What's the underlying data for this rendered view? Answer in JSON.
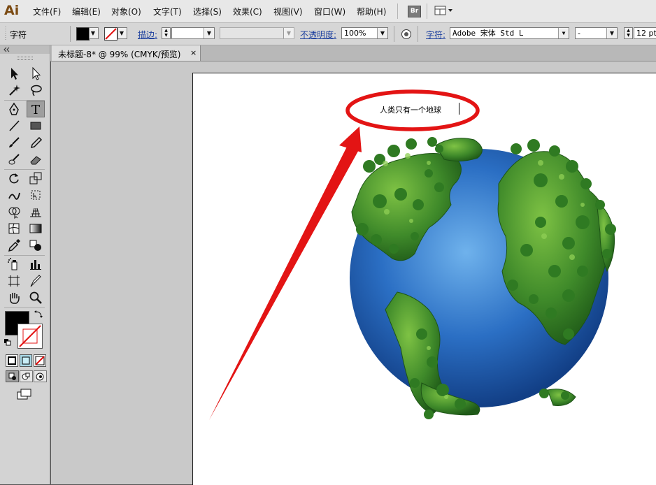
{
  "app": {
    "logo": "Ai",
    "menu": [
      "文件(F)",
      "编辑(E)",
      "对象(O)",
      "文字(T)",
      "选择(S)",
      "效果(C)",
      "视图(V)",
      "窗口(W)",
      "帮助(H)"
    ],
    "bridge_label": "Br"
  },
  "control_bar": {
    "panel_label": "字符",
    "stroke_label": "描边:",
    "opacity_label": "不透明度:",
    "opacity_value": "100%",
    "character_label": "字符:",
    "font_family": "Adobe 宋体 Std L",
    "font_style": "-",
    "font_size": "12 pt"
  },
  "document": {
    "tab_title": "未标题-8* @ 99% (CMYK/预览)",
    "close_glyph": "×",
    "text_content": "人类只有一个地球"
  },
  "colors": {
    "annotation_red": "#e31414",
    "menu_bg": "#e8e8e8",
    "panel_bg": "#d3d3d3",
    "canvas_bg": "#c9c9c9",
    "link_blue": "#1c3f9e",
    "ocean_blue": "#2b6fc4",
    "forest_green": "#3f8a2a"
  },
  "tools": [
    "selection-tool-icon",
    "direct-selection-tool-icon",
    "magic-wand-tool-icon",
    "lasso-tool-icon",
    "pen-tool-icon",
    "type-tool-icon",
    "line-segment-tool-icon",
    "rectangle-tool-icon",
    "paintbrush-tool-icon",
    "pencil-tool-icon",
    "blob-brush-tool-icon",
    "eraser-tool-icon",
    "rotate-tool-icon",
    "scale-tool-icon",
    "warp-tool-icon",
    "free-transform-tool-icon",
    "shape-builder-tool-icon",
    "perspective-grid-tool-icon",
    "mesh-tool-icon",
    "gradient-tool-icon",
    "eyedropper-tool-icon",
    "blend-tool-icon",
    "symbol-sprayer-tool-icon",
    "column-graph-tool-icon",
    "artboard-tool-icon",
    "slice-tool-icon",
    "hand-tool-icon",
    "zoom-tool-icon"
  ]
}
